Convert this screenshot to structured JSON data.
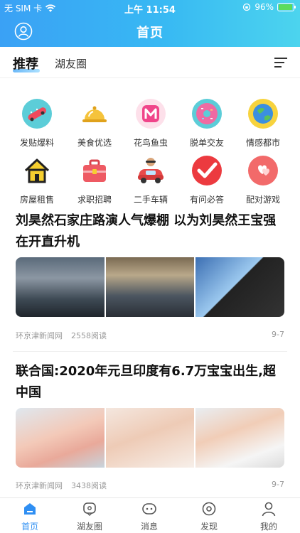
{
  "status": {
    "carrier": "无 SIM 卡",
    "time": "上午 11:54",
    "battery": "96%",
    "battery_level": 0.96
  },
  "nav": {
    "title": "首页"
  },
  "tabs": [
    {
      "label": "推荐",
      "active": true
    },
    {
      "label": "湖友圈",
      "active": false
    }
  ],
  "categories": [
    {
      "label": "发贴爆料",
      "icon": "skateboard-icon"
    },
    {
      "label": "美食优选",
      "icon": "food-cloche-icon"
    },
    {
      "label": "花鸟鱼虫",
      "icon": "m-logo-icon"
    },
    {
      "label": "脱单交友",
      "icon": "donut-icon"
    },
    {
      "label": "情感都市",
      "icon": "globe-icon"
    },
    {
      "label": "房屋租售",
      "icon": "house-icon"
    },
    {
      "label": "求职招聘",
      "icon": "briefcase-icon"
    },
    {
      "label": "二手车辆",
      "icon": "car-icon"
    },
    {
      "label": "有问必答",
      "icon": "checkmark-icon"
    },
    {
      "label": "配对游戏",
      "icon": "hearts-icon"
    }
  ],
  "news": [
    {
      "title": "刘昊然石家庄路演人气爆棚 以为刘昊然王宝强在开直升机",
      "source": "环京津新闻网",
      "views": "2558阅读",
      "date": "9-7"
    },
    {
      "title": "联合国:2020年元旦印度有6.7万宝宝出生,超中国",
      "source": "环京津新闻网",
      "views": "3438阅读",
      "date": "9-7"
    }
  ],
  "tabbar": [
    {
      "label": "首页",
      "icon": "home-icon",
      "active": true
    },
    {
      "label": "湖友圈",
      "icon": "chat-bubble-icon",
      "active": false
    },
    {
      "label": "消息",
      "icon": "message-icon",
      "active": false
    },
    {
      "label": "发现",
      "icon": "compass-icon",
      "active": false
    },
    {
      "label": "我的",
      "icon": "user-icon",
      "active": false
    }
  ],
  "colors": {
    "accent": "#2f8ff3",
    "header_start": "#3aa1f5",
    "header_end": "#4cd4ee"
  }
}
